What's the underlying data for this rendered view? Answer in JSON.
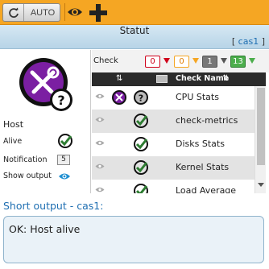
{
  "toolbar": {
    "auto_label": "AUTO"
  },
  "header": {
    "title": "Statut",
    "host_link": "cas1",
    "bracket_open": "[",
    "bracket_close": "]"
  },
  "host_panel": {
    "section_label": "Host",
    "alive_label": "Alive",
    "notification_label": "Notification",
    "notification_count": "5",
    "show_output_label": "Show output"
  },
  "filter": {
    "label": "Check",
    "counts": {
      "red": "0",
      "orange": "0",
      "grey": "1",
      "green": "13"
    }
  },
  "table": {
    "header": {
      "name": "Check Name"
    },
    "rows": [
      {
        "name": "CPU Stats",
        "status": "unknown"
      },
      {
        "name": "check-metrics",
        "status": "ok"
      },
      {
        "name": "Disks Stats",
        "status": "ok"
      },
      {
        "name": "Kernel Stats",
        "status": "ok"
      },
      {
        "name": "Load Average",
        "status": "ok"
      }
    ]
  },
  "output": {
    "title": "Short output - cas1:",
    "text": "OK: Host alive"
  },
  "colors": {
    "toolbar": "#f5a623",
    "accent": "#1f6fb2",
    "ok": "#2e7d32",
    "unknown_bg": "#6a1b9a"
  }
}
